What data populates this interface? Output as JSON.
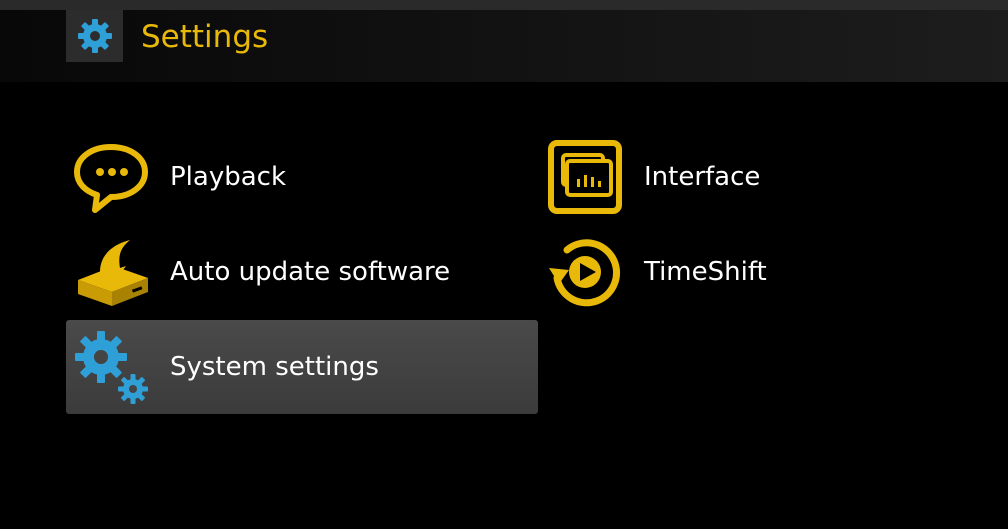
{
  "header": {
    "title": "Settings",
    "icon": "gear-icon"
  },
  "menu": {
    "items": [
      {
        "label": "Playback",
        "icon": "chat-bubble-icon"
      },
      {
        "label": "Auto update software",
        "icon": "update-box-icon"
      },
      {
        "label": "System settings",
        "icon": "gears-icon",
        "selected": true
      },
      {
        "label": "Interface",
        "icon": "interface-icon"
      },
      {
        "label": "TimeShift",
        "icon": "timeshift-icon"
      }
    ]
  },
  "colors": {
    "accent": "#e9b90a",
    "gear_blue": "#2f9fd8",
    "selection": "#444444"
  }
}
